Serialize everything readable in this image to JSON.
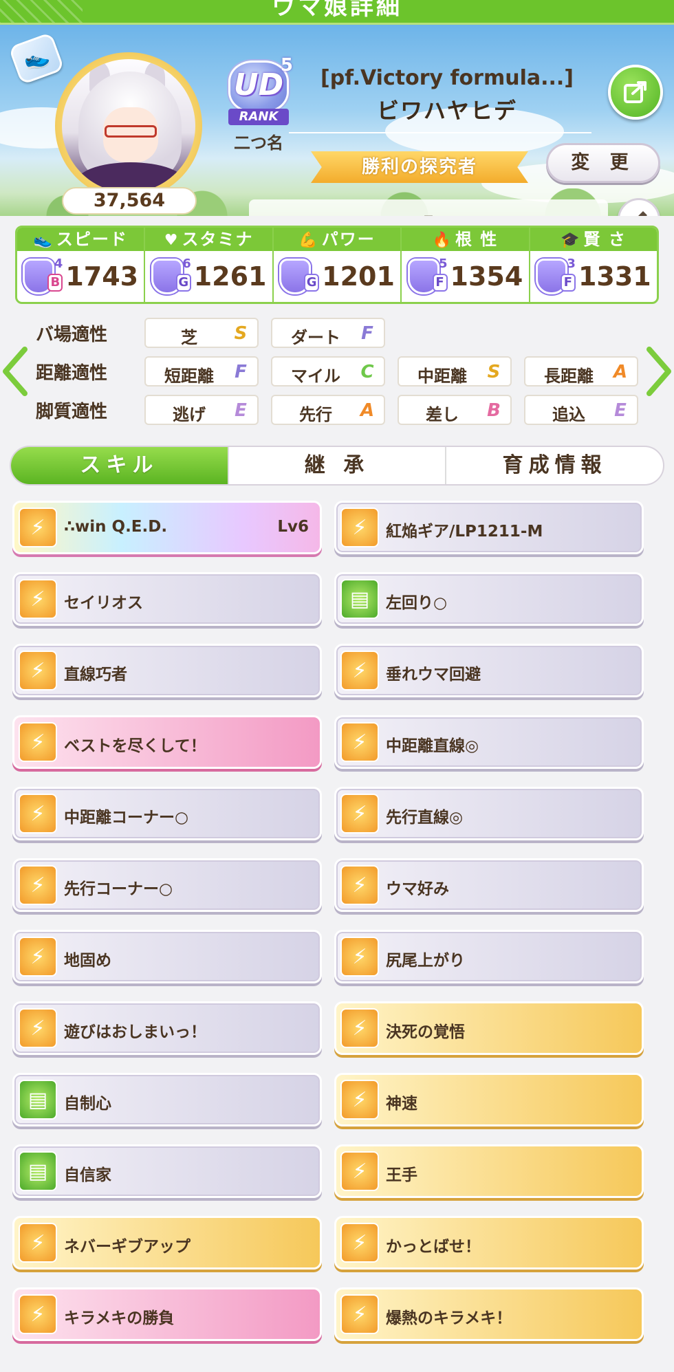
{
  "screen_title": "ウマ娘詳細",
  "header": {
    "fans": "37,564",
    "rank": {
      "letters": "UD",
      "number": "5",
      "label": "RANK"
    },
    "nickname_label": "二つ名",
    "title": "[pf.Victory formula...]",
    "name": "ビワハヤヒデ",
    "epithet": "勝利の探究者",
    "change_label": "変 更",
    "comment": "–"
  },
  "stats": [
    {
      "label": "スピード",
      "icon": "shoe-icon",
      "grade_num": "4",
      "grade_letter": "B",
      "value": "1743",
      "accent": "pink"
    },
    {
      "label": "スタミナ",
      "icon": "heart-icon",
      "grade_num": "6",
      "grade_letter": "G",
      "value": "1261",
      "accent": "purple"
    },
    {
      "label": "パワー",
      "icon": "muscle-icon",
      "grade_num": "",
      "grade_letter": "G",
      "value": "1201",
      "accent": "purple"
    },
    {
      "label": "根 性",
      "icon": "flame-icon",
      "grade_num": "5",
      "grade_letter": "F",
      "value": "1354",
      "accent": "purple"
    },
    {
      "label": "賢 さ",
      "icon": "graduation-cap-icon",
      "grade_num": "3",
      "grade_letter": "F",
      "value": "1331",
      "accent": "purple"
    }
  ],
  "aptitudes": {
    "track": {
      "label": "バ場適性",
      "items": [
        {
          "name": "芝",
          "grade": "S"
        },
        {
          "name": "ダート",
          "grade": "F"
        }
      ]
    },
    "distance": {
      "label": "距離適性",
      "items": [
        {
          "name": "短距離",
          "grade": "F"
        },
        {
          "name": "マイル",
          "grade": "C"
        },
        {
          "name": "中距離",
          "grade": "S"
        },
        {
          "name": "長距離",
          "grade": "A"
        }
      ]
    },
    "strategy": {
      "label": "脚質適性",
      "items": [
        {
          "name": "逃げ",
          "grade": "E"
        },
        {
          "name": "先行",
          "grade": "A"
        },
        {
          "name": "差し",
          "grade": "B"
        },
        {
          "name": "追込",
          "grade": "E"
        }
      ]
    }
  },
  "tabs": [
    {
      "label": "スキル",
      "active": true
    },
    {
      "label": "継 承",
      "active": false
    },
    {
      "label": "育成情報",
      "active": false
    }
  ],
  "skills": [
    {
      "name": "∴win Q.E.D.",
      "level": "Lv6",
      "style": "unique",
      "icon": "orange"
    },
    {
      "name": "紅焔ギア/LP1211-M",
      "style": "normal",
      "icon": "orange"
    },
    {
      "name": "セイリオス",
      "style": "normal",
      "icon": "orange"
    },
    {
      "name": "左回り○",
      "style": "normal",
      "icon": "green"
    },
    {
      "name": "直線巧者",
      "style": "normal",
      "icon": "orange"
    },
    {
      "name": "垂れウマ回避",
      "style": "normal",
      "icon": "orange"
    },
    {
      "name": "ベストを尽くして！",
      "style": "pink",
      "icon": "orange"
    },
    {
      "name": "中距離直線◎",
      "style": "normal",
      "icon": "orange"
    },
    {
      "name": "中距離コーナー○",
      "style": "normal",
      "icon": "orange"
    },
    {
      "name": "先行直線◎",
      "style": "normal",
      "icon": "orange"
    },
    {
      "name": "先行コーナー○",
      "style": "normal",
      "icon": "orange"
    },
    {
      "name": "ウマ好み",
      "style": "normal",
      "icon": "orange"
    },
    {
      "name": "地固め",
      "style": "normal",
      "icon": "orange"
    },
    {
      "name": "尻尾上がり",
      "style": "normal",
      "icon": "orange"
    },
    {
      "name": "遊びはおしまいっ！",
      "style": "normal",
      "icon": "orange"
    },
    {
      "name": "決死の覚悟",
      "style": "gold",
      "icon": "orange"
    },
    {
      "name": "自制心",
      "style": "normal",
      "icon": "green"
    },
    {
      "name": "神速",
      "style": "gold",
      "icon": "orange"
    },
    {
      "name": "自信家",
      "style": "normal",
      "icon": "green"
    },
    {
      "name": "王手",
      "style": "gold",
      "icon": "orange"
    },
    {
      "name": "ネバーギブアップ",
      "style": "gold",
      "icon": "orange"
    },
    {
      "name": "かっとばせ！",
      "style": "gold",
      "icon": "orange"
    },
    {
      "name": "キラメキの勝負",
      "style": "pink",
      "icon": "orange"
    },
    {
      "name": "爆熱のキラメキ！",
      "style": "gold",
      "icon": "orange"
    }
  ]
}
